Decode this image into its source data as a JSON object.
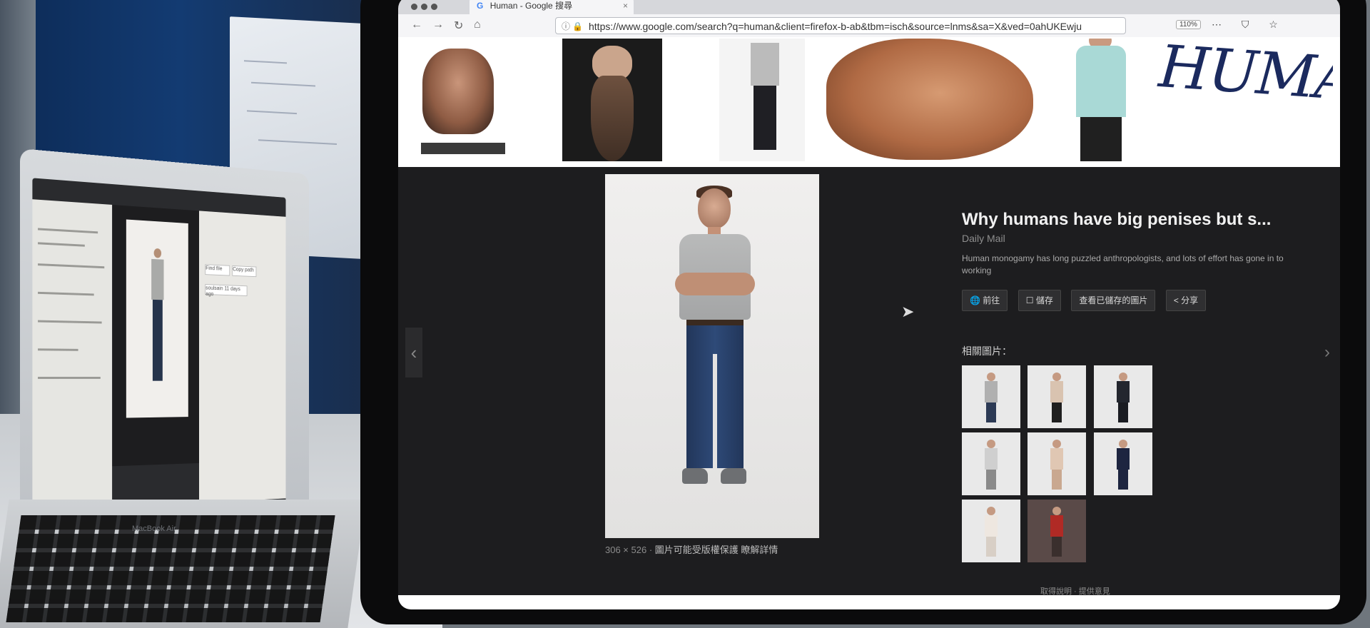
{
  "browser": {
    "tab_title": "Human - Google 搜尋",
    "tab_close": "×",
    "url": "https://www.google.com/search?q=human&client=firefox-b-ab&tbm=isch&source=lnms&sa=X&ved=0ahUKEwju",
    "zoom": "110%",
    "nav": {
      "back": "←",
      "forward": "→",
      "reload": "↻",
      "home": "⌂"
    },
    "toolbar_icons": "⋯ ⛉ ☆"
  },
  "strip": {
    "logo_text": "HUMAN"
  },
  "preview": {
    "nav_prev": "‹",
    "nav_next": "›",
    "image_caption_size": "306 × 526",
    "image_caption_text": "圖片可能受版權保護",
    "image_caption_link": "瞭解詳情",
    "title": "Why humans have big penises but s...",
    "source": "Daily Mail",
    "description": "Human monogamy has long puzzled anthropologists, and lots of effort has gone in to working",
    "buttons": {
      "visit": "前往",
      "save": "儲存",
      "view_saved": "查看已儲存的圖片",
      "share": "分享"
    },
    "related_label": "相關圖片：",
    "footer_link_1": "取得說明",
    "footer_link_2": "提供意見"
  },
  "laptop": {
    "brand": "MacBook Air",
    "chip_1": "Find file",
    "chip_2": "Copy path",
    "chip_3": "soulsain 11 days ago"
  },
  "colors": {
    "google_blue": "#4285f4",
    "preview_bg": "#1d1d1f",
    "logo_navy": "#1b2a5e"
  }
}
